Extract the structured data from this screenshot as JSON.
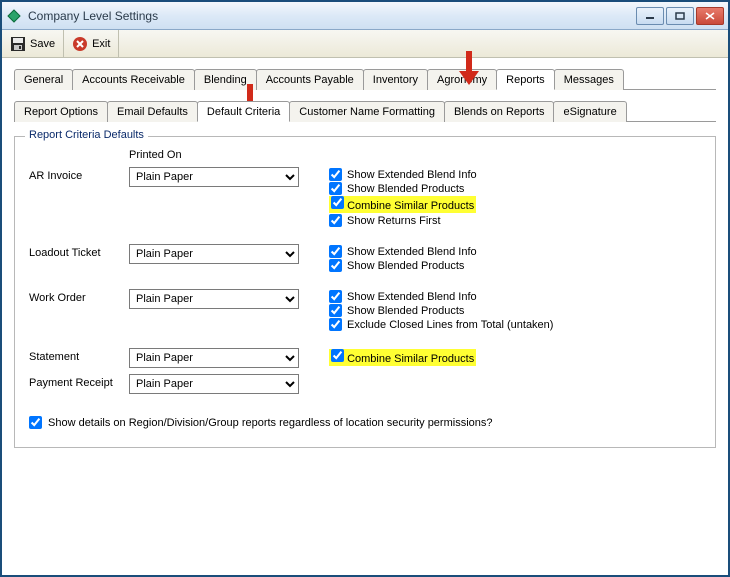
{
  "window": {
    "title": "Company Level Settings"
  },
  "toolbar": {
    "save_label": "Save",
    "exit_label": "Exit"
  },
  "tabs_main": [
    {
      "label": "General",
      "active": false
    },
    {
      "label": "Accounts Receivable",
      "active": false
    },
    {
      "label": "Blending",
      "active": false
    },
    {
      "label": "Accounts Payable",
      "active": false
    },
    {
      "label": "Inventory",
      "active": false
    },
    {
      "label": "Agronomy",
      "active": false
    },
    {
      "label": "Reports",
      "active": true
    },
    {
      "label": "Messages",
      "active": false
    }
  ],
  "tabs_sub": [
    {
      "label": "Report Options",
      "active": false
    },
    {
      "label": "Email Defaults",
      "active": false
    },
    {
      "label": "Default Criteria",
      "active": true
    },
    {
      "label": "Customer Name Formatting",
      "active": false
    },
    {
      "label": "Blends on Reports",
      "active": false
    },
    {
      "label": "eSignature",
      "active": false
    }
  ],
  "group": {
    "legend": "Report Criteria Defaults",
    "printed_on_label": "Printed On",
    "rows": {
      "ar_invoice": {
        "label": "AR Invoice",
        "value": "Plain Paper",
        "checks": [
          {
            "label": "Show Extended Blend Info",
            "checked": true,
            "highlight": false
          },
          {
            "label": "Show Blended Products",
            "checked": true,
            "highlight": false
          },
          {
            "label": "Combine Similar Products",
            "checked": true,
            "highlight": true
          },
          {
            "label": "Show Returns First",
            "checked": true,
            "highlight": false
          }
        ]
      },
      "loadout_ticket": {
        "label": "Loadout Ticket",
        "value": "Plain Paper",
        "checks": [
          {
            "label": "Show Extended Blend Info",
            "checked": true,
            "highlight": false
          },
          {
            "label": "Show Blended Products",
            "checked": true,
            "highlight": false
          }
        ]
      },
      "work_order": {
        "label": "Work Order",
        "value": "Plain Paper",
        "checks": [
          {
            "label": "Show Extended Blend Info",
            "checked": true,
            "highlight": false
          },
          {
            "label": "Show Blended Products",
            "checked": true,
            "highlight": false
          },
          {
            "label": "Exclude Closed Lines from Total (untaken)",
            "checked": true,
            "highlight": false
          }
        ]
      },
      "statement": {
        "label": "Statement",
        "value": "Plain Paper",
        "checks": [
          {
            "label": "Combine Similar Products",
            "checked": true,
            "highlight": true
          }
        ]
      },
      "payment_receipt": {
        "label": "Payment Receipt",
        "value": "Plain Paper",
        "checks": []
      }
    },
    "footer_check": {
      "label": "Show details on Region/Division/Group reports regardless of location security permissions?",
      "checked": true
    }
  }
}
